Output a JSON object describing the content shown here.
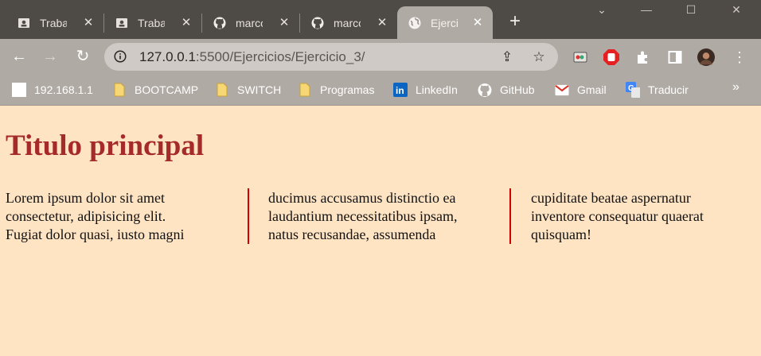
{
  "tabs": [
    {
      "title": "Trabajo",
      "icon": "classroom-icon"
    },
    {
      "title": "Trabajo",
      "icon": "classroom-icon"
    },
    {
      "title": "marcos",
      "icon": "github-icon"
    },
    {
      "title": "marcos",
      "icon": "github-icon"
    },
    {
      "title": "Ejercicio",
      "icon": "globe-icon",
      "active": true
    }
  ],
  "address": {
    "host": "127.0.0.1",
    "path": ":5500/Ejercicios/Ejercicio_3/"
  },
  "bookmarks": [
    {
      "label": "192.168.1.1",
      "icon": "page-icon"
    },
    {
      "label": "BOOTCAMP",
      "icon": "folder-icon"
    },
    {
      "label": "SWITCH",
      "icon": "folder-icon"
    },
    {
      "label": "Programas",
      "icon": "folder-icon"
    },
    {
      "label": "LinkedIn",
      "icon": "linkedin-icon"
    },
    {
      "label": "GitHub",
      "icon": "github-icon"
    },
    {
      "label": "Gmail",
      "icon": "gmail-icon"
    },
    {
      "label": "Traducir",
      "icon": "translate-icon"
    }
  ],
  "page": {
    "title": "Titulo principal",
    "columns": [
      [
        "Lorem ipsum dolor sit amet",
        "consectetur, adipisicing elit.",
        "Fugiat dolor quasi, iusto magni"
      ],
      [
        "ducimus accusamus distinctio ea",
        "laudantium necessitatibus ipsam,",
        "natus recusandae, assumenda"
      ],
      [
        "cupiditate beatae aspernatur",
        "inventore consequatur quaerat",
        "quisquam!"
      ]
    ]
  },
  "colors": {
    "background": "#ffe4c4",
    "title": "#a52a2a",
    "rule": "#d40000",
    "chrome": "#b0aaa4",
    "tabstrip": "#4e4a45"
  }
}
